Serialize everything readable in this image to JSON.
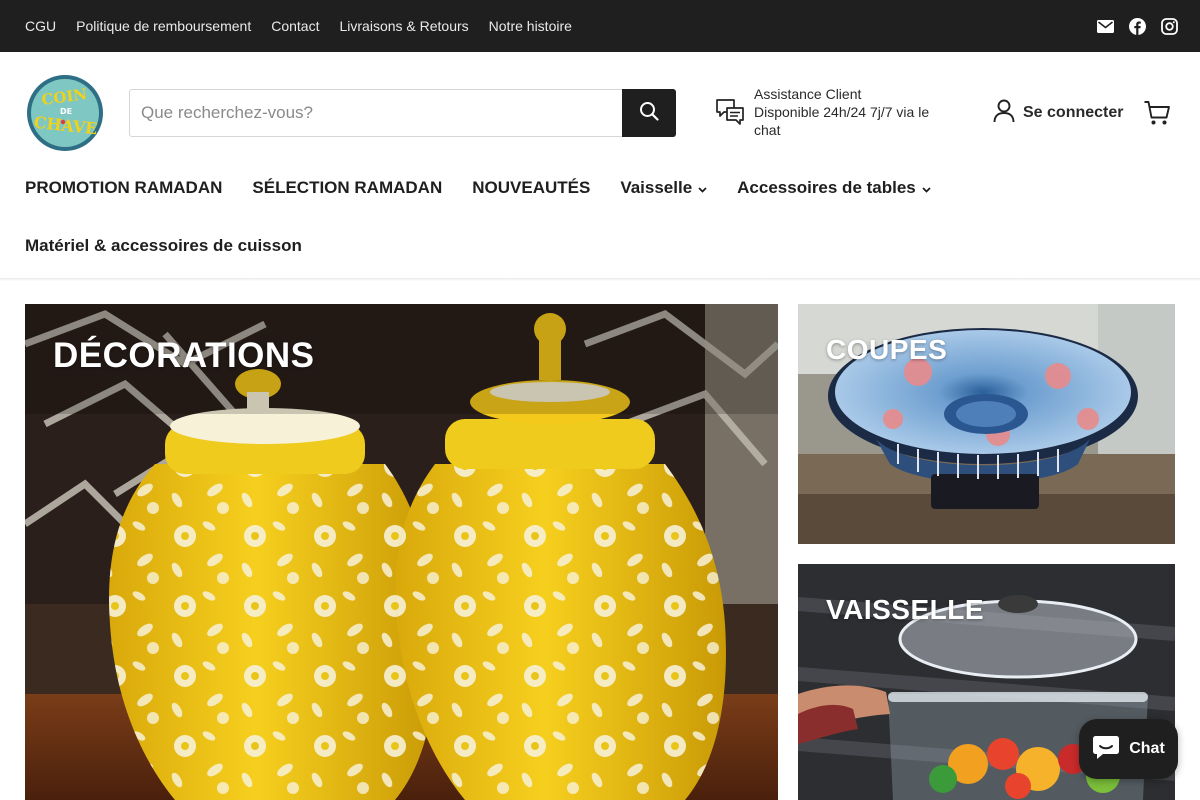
{
  "topbar": {
    "links": [
      "CGU",
      "Politique de remboursement",
      "Contact",
      "Livraisons & Retours",
      "Notre histoire"
    ],
    "social_icons": [
      "email-icon",
      "facebook-icon",
      "instagram-icon"
    ]
  },
  "header": {
    "logo_text": "COIN DE CHAVE",
    "search_placeholder": "Que recherchez-vous?",
    "support_title": "Assistance Client",
    "support_text": "Disponible 24h/24 7j/7 via le chat",
    "login_label": "Se connecter"
  },
  "nav": {
    "items": [
      {
        "label": "PROMOTION RAMADAN",
        "dropdown": false
      },
      {
        "label": "SÉLECTION RAMADAN",
        "dropdown": false
      },
      {
        "label": "NOUVEAUTÉS",
        "dropdown": false
      },
      {
        "label": "Vaisselle",
        "dropdown": true
      },
      {
        "label": "Accessoires de tables",
        "dropdown": true
      },
      {
        "label": "Matériel & accessoires de cuisson",
        "dropdown": false
      }
    ]
  },
  "tiles": [
    {
      "title": "DÉCORATIONS"
    },
    {
      "title": "COUPES"
    },
    {
      "title": "VAISSELLE"
    }
  ],
  "chat": {
    "label": "Chat"
  },
  "colors": {
    "topbar": "#1f1f1f",
    "accent": "#1f1f1f",
    "jar_yellow": "#f1c419",
    "bowl_blue": "#2a5f99"
  }
}
